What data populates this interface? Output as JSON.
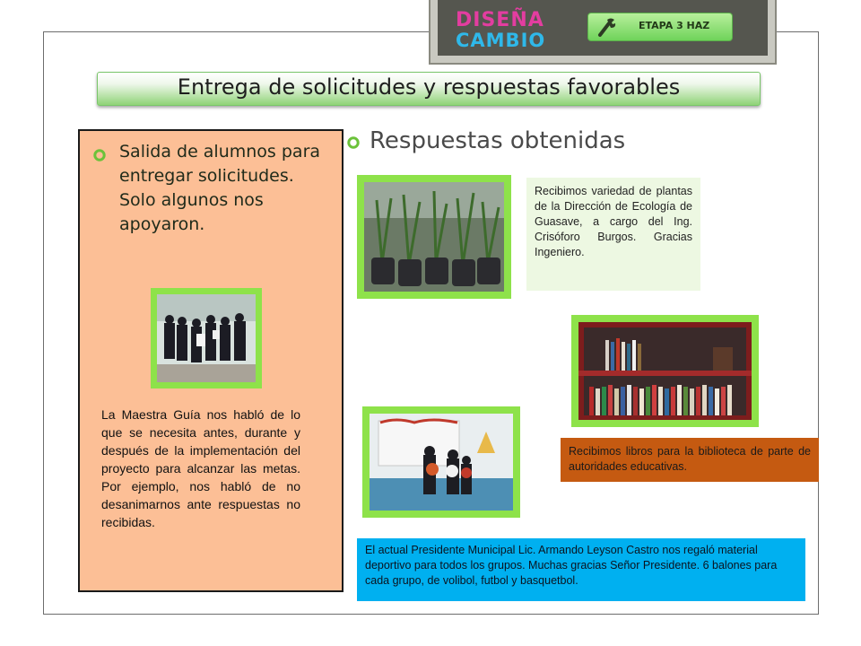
{
  "slide": {
    "title": "Entrega de solicitudes y respuestas favorables"
  },
  "banner": {
    "logo_line1": "DISEÑA",
    "logo_line2": "CAMBIO",
    "stage_label": "ETAPA 3 HAZ",
    "stage_icon": "wrench-icon"
  },
  "left": {
    "heading": "Salida de alumnos para entregar solicitudes. Solo algunos nos apoyaron.",
    "guide_text": "La Maestra Guía nos habló de lo que se necesita antes, durante y después de la implementación del proyecto para alcanzar las metas. Por ejemplo, nos habló de no desanimarnos ante respuestas no recibidas.",
    "panel_color": "#fcbf96"
  },
  "right": {
    "heading": "Respuestas obtenidas",
    "plants_note": "Recibimos variedad de plantas de la Dirección de Ecología de Guasave, a cargo del Ing. Crisóforo Burgos. Gracias Ingeniero.",
    "books_note": "Recibimos libros para la biblioteca de parte de autoridades educativas.",
    "president_note": "El actual Presidente Municipal Lic. Armando Leyson Castro nos regaló material deportivo para todos los grupos. Muchas gracias Señor Presidente. 6 balones para cada grupo, de volibol, futbol y basquetbol."
  },
  "colors": {
    "accent_green": "#8ee24a",
    "books_note_bg": "#c55a11",
    "president_note_bg": "#00b0f0",
    "plants_note_bg": "#edf8e2"
  }
}
